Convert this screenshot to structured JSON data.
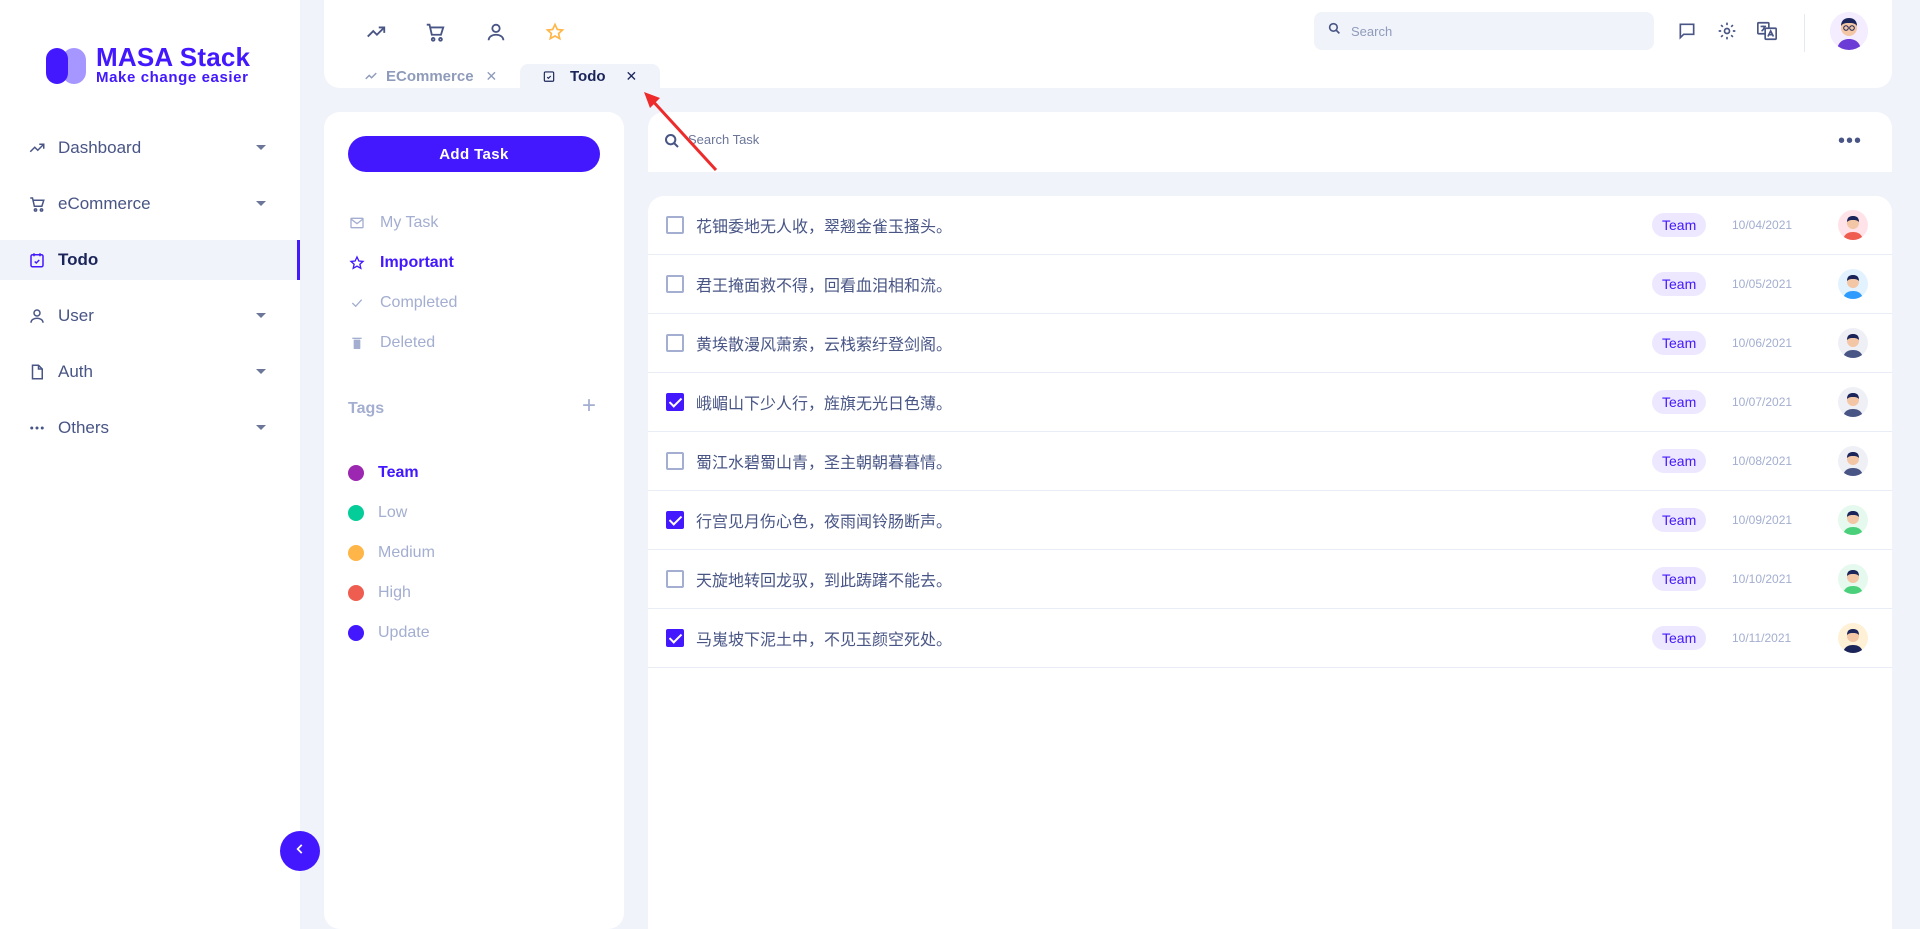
{
  "brand": {
    "name": "MASA Stack",
    "tagline": "Make change easier"
  },
  "sidebar": {
    "items": [
      {
        "label": "Dashboard",
        "icon": "trending-up-icon",
        "has_caret": true
      },
      {
        "label": "eCommerce",
        "icon": "cart-icon",
        "has_caret": true
      },
      {
        "label": "Todo",
        "icon": "calendar-check-icon",
        "active": true
      },
      {
        "label": "User",
        "icon": "user-icon",
        "has_caret": true
      },
      {
        "label": "Auth",
        "icon": "file-icon",
        "has_caret": true
      },
      {
        "label": "Others",
        "icon": "dots-icon",
        "has_caret": true
      }
    ]
  },
  "topbar": {
    "quick_icons": [
      "trending-up-icon",
      "cart-icon",
      "user-icon",
      "star-icon"
    ],
    "search_placeholder": "Search",
    "right_icons": [
      "message-icon",
      "gear-icon",
      "translate-icon"
    ]
  },
  "tabs": [
    {
      "label": "ECommerce",
      "icon": "trending-up-icon"
    },
    {
      "label": "Todo",
      "icon": "calendar-check-icon",
      "active": true
    }
  ],
  "todo": {
    "add_task": "Add Task",
    "filters": [
      {
        "label": "My Task",
        "icon": "mail-icon"
      },
      {
        "label": "Important",
        "icon": "star-icon",
        "active": true
      },
      {
        "label": "Completed",
        "icon": "check-icon"
      },
      {
        "label": "Deleted",
        "icon": "trash-icon"
      }
    ],
    "tags_title": "Tags",
    "tags": [
      {
        "label": "Team",
        "color": "#9c27b0",
        "active": true
      },
      {
        "label": "Low",
        "color": "#05cd99"
      },
      {
        "label": "Medium",
        "color": "#ffb547"
      },
      {
        "label": "High",
        "color": "#ee5d50"
      },
      {
        "label": "Update",
        "color": "#4318ff"
      }
    ],
    "search_placeholder": "Search Task",
    "tasks": [
      {
        "text": "花钿委地无人收，翠翘金雀玉搔头。",
        "tag": "Team",
        "date": "10/04/2021",
        "checked": false,
        "avatar_color": "#ffe3e8",
        "shirt": "#ee5d50"
      },
      {
        "text": "君王掩面救不得，回看血泪相和流。",
        "tag": "Team",
        "date": "10/05/2021",
        "checked": false,
        "avatar_color": "#e3f2ff",
        "shirt": "#2e9cff"
      },
      {
        "text": "黄埃散漫风萧索，云栈萦纡登剑阁。",
        "tag": "Team",
        "date": "10/06/2021",
        "checked": false,
        "avatar_color": "#eef0f6",
        "shirt": "#485585"
      },
      {
        "text": "峨嵋山下少人行，旌旗无光日色薄。",
        "tag": "Team",
        "date": "10/07/2021",
        "checked": true,
        "avatar_color": "#eef0f6",
        "shirt": "#485585"
      },
      {
        "text": "蜀江水碧蜀山青，圣主朝朝暮暮情。",
        "tag": "Team",
        "date": "10/08/2021",
        "checked": false,
        "avatar_color": "#eef0f6",
        "shirt": "#485585"
      },
      {
        "text": "行宫见月伤心色，夜雨闻铃肠断声。",
        "tag": "Team",
        "date": "10/09/2021",
        "checked": true,
        "avatar_color": "#e6f9ee",
        "shirt": "#4ad07a"
      },
      {
        "text": "天旋地转回龙驭，到此踌躇不能去。",
        "tag": "Team",
        "date": "10/10/2021",
        "checked": false,
        "avatar_color": "#e6f9ee",
        "shirt": "#4ad07a"
      },
      {
        "text": "马嵬坡下泥土中，不见玉颜空死处。",
        "tag": "Team",
        "date": "10/11/2021",
        "checked": true,
        "avatar_color": "#fff1d6",
        "shirt": "#1b2559"
      }
    ]
  },
  "colors": {
    "accent": "#4318ff",
    "text": "#485585",
    "muted": "#a3aed0",
    "bg": "#f0f3fa"
  }
}
